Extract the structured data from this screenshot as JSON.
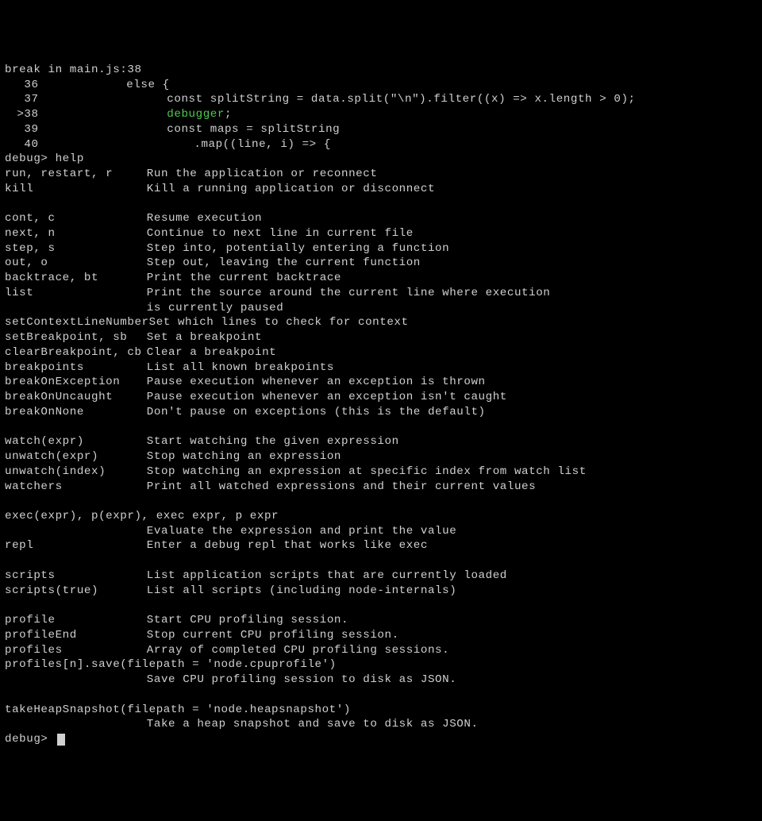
{
  "break_line": "break in main.js:38",
  "source": {
    "lines": [
      {
        "num": "36",
        "current": false,
        "indent": 1,
        "code": "else {"
      },
      {
        "num": "37",
        "current": false,
        "indent": 2,
        "code": "const splitString = data.split(\"\\n\").filter((x) => x.length > 0);"
      },
      {
        "num": ">38",
        "current": true,
        "indent": 2,
        "kw": "debugger",
        "code": ";"
      },
      {
        "num": "39",
        "current": false,
        "indent": 2,
        "code": "const maps = splitString"
      },
      {
        "num": "40",
        "current": false,
        "indent": 3,
        "code": ".map((line, i) => {"
      }
    ]
  },
  "prompt_help": "debug> help",
  "help": [
    {
      "cmd": "run, restart, r",
      "desc": "Run the application or reconnect"
    },
    {
      "cmd": "kill",
      "desc": "Kill a running application or disconnect"
    },
    {
      "cmd": "",
      "desc": ""
    },
    {
      "cmd": "cont, c",
      "desc": "Resume execution"
    },
    {
      "cmd": "next, n",
      "desc": "Continue to next line in current file"
    },
    {
      "cmd": "step, s",
      "desc": "Step into, potentially entering a function"
    },
    {
      "cmd": "out, o",
      "desc": "Step out, leaving the current function"
    },
    {
      "cmd": "backtrace, bt",
      "desc": "Print the current backtrace"
    },
    {
      "cmd": "list",
      "desc": "Print the source around the current line where execution"
    },
    {
      "cmd": "",
      "desc": "is currently paused"
    },
    {
      "cmd": "setContextLineNumber",
      "desc": "Set which lines to check for context"
    },
    {
      "cmd": "setBreakpoint, sb",
      "desc": "Set a breakpoint"
    },
    {
      "cmd": "clearBreakpoint, cb",
      "desc": "Clear a breakpoint"
    },
    {
      "cmd": "breakpoints",
      "desc": "List all known breakpoints"
    },
    {
      "cmd": "breakOnException",
      "desc": "Pause execution whenever an exception is thrown"
    },
    {
      "cmd": "breakOnUncaught",
      "desc": "Pause execution whenever an exception isn't caught"
    },
    {
      "cmd": "breakOnNone",
      "desc": "Don't pause on exceptions (this is the default)"
    },
    {
      "cmd": "",
      "desc": ""
    },
    {
      "cmd": "watch(expr)",
      "desc": "Start watching the given expression"
    },
    {
      "cmd": "unwatch(expr)",
      "desc": "Stop watching an expression"
    },
    {
      "cmd": "unwatch(index)",
      "desc": "Stop watching an expression at specific index from watch list"
    },
    {
      "cmd": "watchers",
      "desc": "Print all watched expressions and their current values"
    },
    {
      "cmd": "",
      "desc": ""
    },
    {
      "full": "exec(expr), p(expr), exec expr, p expr"
    },
    {
      "cmd": "",
      "desc": "Evaluate the expression and print the value"
    },
    {
      "cmd": "repl",
      "desc": "Enter a debug repl that works like exec"
    },
    {
      "cmd": "",
      "desc": ""
    },
    {
      "cmd": "scripts",
      "desc": "List application scripts that are currently loaded"
    },
    {
      "cmd": "scripts(true)",
      "desc": "List all scripts (including node-internals)"
    },
    {
      "cmd": "",
      "desc": ""
    },
    {
      "cmd": "profile",
      "desc": "Start CPU profiling session."
    },
    {
      "cmd": "profileEnd",
      "desc": "Stop current CPU profiling session."
    },
    {
      "cmd": "profiles",
      "desc": "Array of completed CPU profiling sessions."
    },
    {
      "full": "profiles[n].save(filepath = 'node.cpuprofile')"
    },
    {
      "cmd": "",
      "desc": "Save CPU profiling session to disk as JSON."
    },
    {
      "cmd": "",
      "desc": ""
    },
    {
      "full": "takeHeapSnapshot(filepath = 'node.heapsnapshot')"
    },
    {
      "cmd": "",
      "desc": "Take a heap snapshot and save to disk as JSON."
    }
  ],
  "prompt_final": "debug> "
}
